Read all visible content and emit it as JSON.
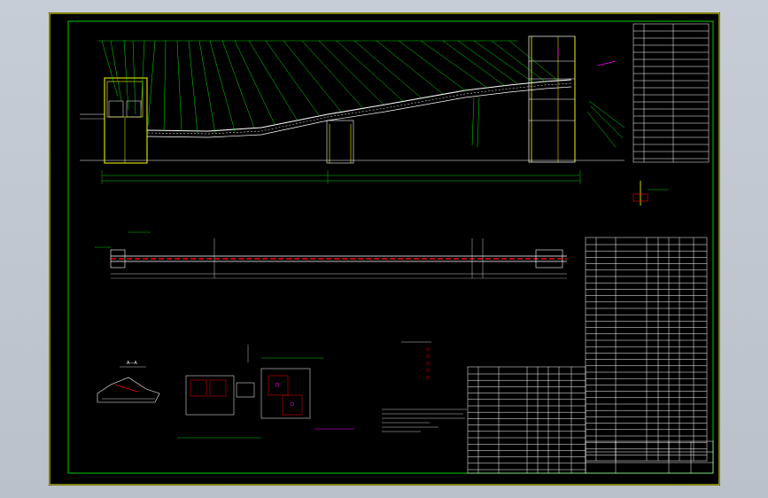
{
  "drawing": {
    "section_label": "A—A",
    "colors": {
      "background": "#000000",
      "border": "#ffff00",
      "inner_frame": "#00ff00",
      "leader_lines": "#00ff00",
      "structure": "#ffffff",
      "supports": "#ffff00",
      "idlers": "#ff0000",
      "annotation": "#ff00ff",
      "tables": "#ffffff"
    },
    "views": [
      "elevation",
      "plan",
      "section-a-a",
      "detail-head",
      "detail-tail",
      "detail-support"
    ],
    "tables": [
      "parts-list-top-right",
      "parts-list-right",
      "parts-list-bottom",
      "title-block"
    ]
  }
}
